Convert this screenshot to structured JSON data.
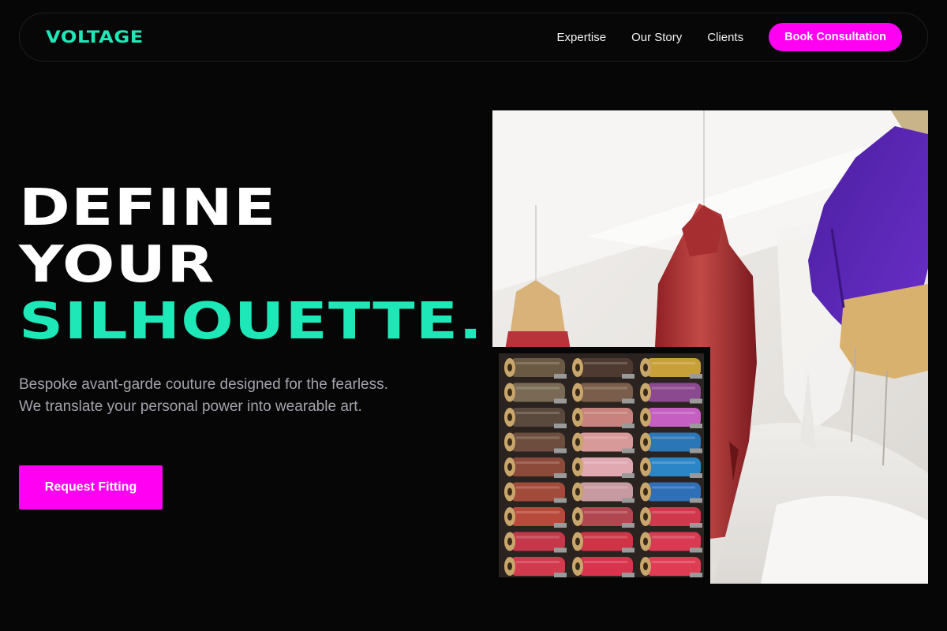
{
  "brand": {
    "name": "VOLTAGE"
  },
  "nav": {
    "links": [
      "Expertise",
      "Our Story",
      "Clients"
    ],
    "cta_label": "Book Consultation"
  },
  "hero": {
    "headline_line1": "DEFINE",
    "headline_line2": "YOUR",
    "headline_line3": "SILHOUETTE.",
    "subcopy": "Bespoke avant-garde couture designed for the fearless. We translate your personal power into wearable art.",
    "cta_label": "Request Fitting"
  },
  "colors": {
    "background": "#060607",
    "accent_teal": "#1fe8b8",
    "accent_magenta": "#ff00f2",
    "body_text": "#a3a3ab"
  }
}
